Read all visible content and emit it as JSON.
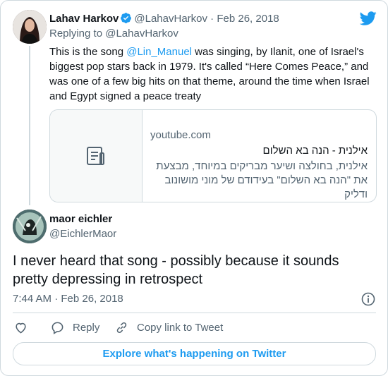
{
  "colors": {
    "accent": "#1d9bf0",
    "text": "#0f1419",
    "muted": "#536471",
    "border": "#cfd9de"
  },
  "tweet1": {
    "name": "Lahav Harkov",
    "handle": "@LahavHarkov",
    "separator": "·",
    "date": "Feb 26, 2018",
    "verified": true,
    "replying_prefix": "Replying to ",
    "replying_to": "@LahavHarkov",
    "text_before": "This is the song ",
    "mention": "@Lin_Manuel",
    "text_after": " was singing, by Ilanit, one of Israel's biggest pop stars back in 1979. It's called “Here Comes Peace,” and was one of a few big hits on that theme, around the time when Israel and Egypt signed a peace treaty",
    "link_card": {
      "domain": "youtube.com",
      "title": "אילנית - הנה בא השלום",
      "description": "אילנית, בחולצה ושיער מבריקים במיוחד, מבצעת את \"הנה בא השלום\" בעידודם של מוני מושונוב ודליק",
      "thumbnail_icon": "document-icon"
    }
  },
  "tweet2": {
    "name": "maor eichler",
    "handle": "@EichlerMaor",
    "text": "I never heard that song - possibly because it sounds pretty depressing in retrospect",
    "timestamp": "7:44 AM · Feb 26, 2018"
  },
  "actions": {
    "like_icon": "heart-icon",
    "reply_label": "Reply",
    "reply_icon": "speech-bubble-icon",
    "copy_label": "Copy link to Tweet",
    "copy_icon": "link-icon"
  },
  "explore_label": "Explore what's happening on Twitter"
}
